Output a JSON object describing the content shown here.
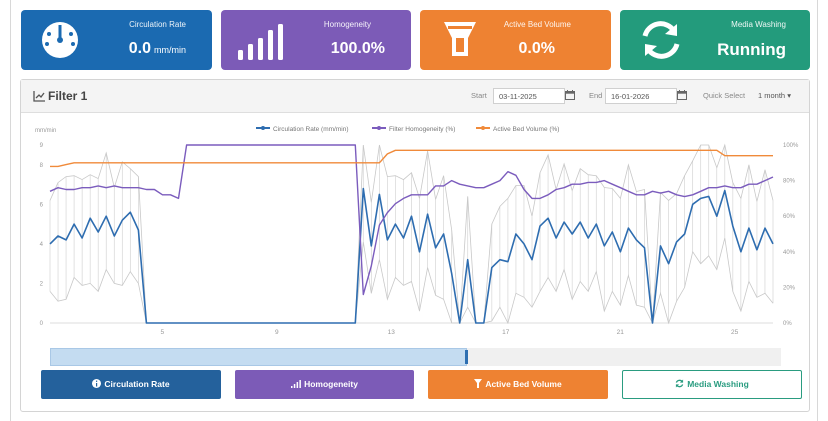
{
  "kpis": [
    {
      "label": "Circulation Rate",
      "value": "0.0",
      "unit": "mm/min",
      "icon": "gauge-icon",
      "color": "#1b6ab1"
    },
    {
      "label": "Homogeneity",
      "value": "100.0%",
      "unit": "",
      "icon": "bar-signal-icon",
      "color": "#7c5bb7"
    },
    {
      "label": "Active Bed Volume",
      "value": "0.0%",
      "unit": "",
      "icon": "filter-funnel-icon",
      "color": "#ee8232"
    },
    {
      "label": "Media Washing",
      "value": "Running",
      "unit": "",
      "icon": "refresh-icon",
      "color": "#239b7c"
    }
  ],
  "panel": {
    "title": "Filter 1",
    "start_label": "Start",
    "start_value": "03-11-2025",
    "end_label": "End",
    "end_value": "16-01-2026",
    "quick_label": "Quick Select",
    "quick_value": "1 month"
  },
  "chart_data": {
    "type": "line",
    "ylabel_left": "mm/min",
    "y_left_ticks": [
      "0",
      "2",
      "4",
      "6",
      "8",
      "9"
    ],
    "y_right_ticks": [
      "0%",
      "20%",
      "40%",
      "60%",
      "80%",
      "100%"
    ],
    "x_ticks": [
      "5",
      "9",
      "13",
      "17",
      "21",
      "25"
    ],
    "series": [
      {
        "name": "Circulation Rate (mm/min)",
        "color": "#2e6db0",
        "axis": "left",
        "values": [
          4.0,
          4.4,
          4.2,
          5.0,
          4.3,
          5.3,
          4.6,
          5.4,
          4.4,
          5.2,
          5.6,
          4.7,
          0,
          0,
          0,
          0,
          0,
          0,
          0,
          0,
          0,
          0,
          0,
          0,
          0,
          0,
          0,
          0,
          0,
          0,
          0,
          0,
          0,
          0,
          0,
          0,
          0,
          0,
          0,
          6.8,
          3.9,
          6.5,
          4.2,
          5.0,
          4.3,
          5.4,
          3.6,
          5.5,
          3.8,
          4.5,
          2.5,
          0,
          3.2,
          0,
          0,
          2.8,
          3.2,
          3.1,
          4.5,
          4.0,
          3.2,
          4.9,
          5.3,
          4.3,
          5.1,
          4.5,
          5.1,
          4.3,
          5.0,
          3.9,
          4.6,
          3.6,
          4.8,
          4.2,
          3.8,
          0,
          3.9,
          3.0,
          4.1,
          4.5,
          6.0,
          6.3,
          6.4,
          5.4,
          6.7,
          4.9,
          3.6,
          4.8,
          3.7,
          4.8,
          4.0
        ]
      },
      {
        "name": "Filter Homogeneity (%)",
        "color": "#7b5cbd",
        "axis": "right",
        "values": [
          74,
          76,
          75,
          75,
          76,
          76,
          77,
          76,
          77,
          76,
          76,
          76,
          75,
          75,
          72,
          72,
          70,
          100,
          100,
          100,
          100,
          100,
          100,
          100,
          100,
          100,
          100,
          100,
          100,
          100,
          100,
          100,
          100,
          100,
          100,
          100,
          100,
          100,
          100,
          16,
          32,
          55,
          62,
          67,
          70,
          72,
          72,
          72,
          77,
          77,
          80,
          78,
          77,
          76,
          76,
          78,
          80,
          85,
          83,
          75,
          70,
          70,
          72,
          75,
          76,
          78,
          78,
          79,
          79,
          80,
          78,
          76,
          74,
          72,
          72,
          74,
          73,
          74,
          72,
          71,
          72,
          74,
          76,
          76,
          77,
          76,
          76,
          78,
          78,
          80,
          82
        ]
      },
      {
        "name": "Active Bed Volume (%)",
        "color": "#f08a3a",
        "axis": "right",
        "values": [
          88,
          88,
          89,
          90,
          90,
          90,
          90,
          90,
          90,
          90,
          90,
          90,
          90,
          90,
          90,
          90,
          90,
          90,
          90,
          90,
          90,
          90,
          90,
          90,
          90,
          90,
          90,
          90,
          90,
          90,
          90,
          90,
          90,
          90,
          90,
          90,
          90,
          90,
          90,
          90,
          90,
          90,
          95,
          97,
          97,
          97,
          97,
          97,
          97,
          97,
          97,
          97,
          97,
          97,
          97,
          97,
          97,
          97,
          97,
          97,
          97,
          97,
          97,
          97,
          97,
          97,
          97,
          97,
          97,
          97,
          97,
          97,
          97,
          97,
          97,
          97,
          97,
          97,
          97,
          97,
          97,
          97,
          97,
          97,
          94,
          94,
          94,
          94,
          94,
          94,
          94
        ]
      }
    ]
  },
  "range_selector": {
    "selected_fraction": 0.57
  },
  "buttons": [
    {
      "label": "Circulation Rate",
      "icon": "info-circle-icon"
    },
    {
      "label": "Homogeneity",
      "icon": "bar-signal-icon"
    },
    {
      "label": "Active Bed Volume",
      "icon": "filter-funnel-icon"
    },
    {
      "label": "Media Washing",
      "icon": "refresh-icon"
    }
  ]
}
